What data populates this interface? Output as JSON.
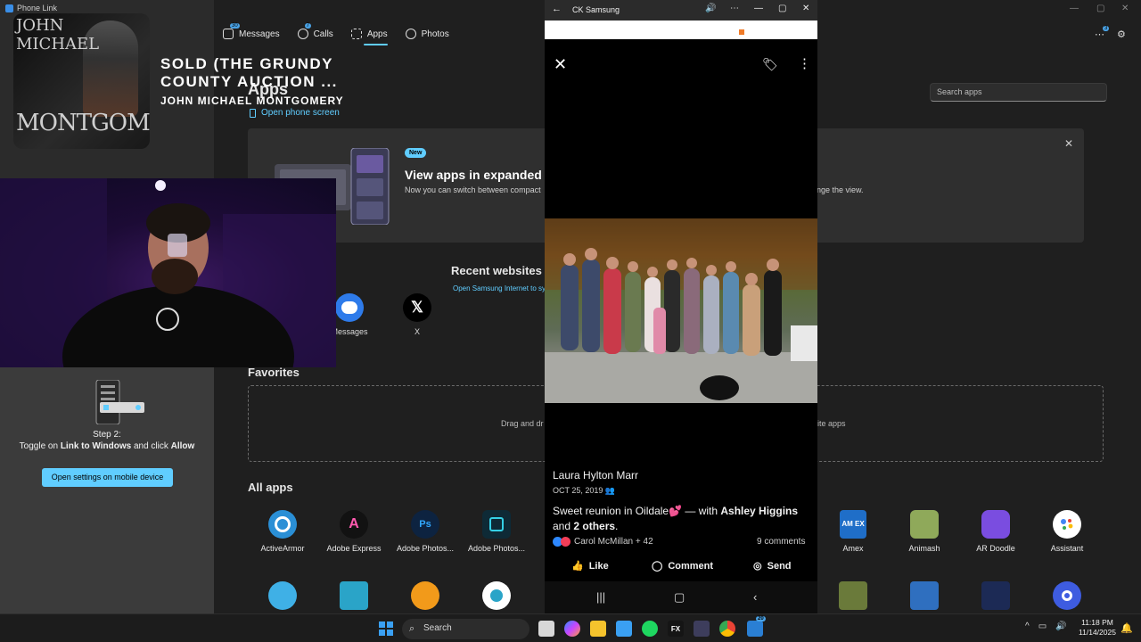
{
  "phonelink": {
    "window_title": "Phone Link",
    "nav": [
      {
        "label": "Messages",
        "badge": "30"
      },
      {
        "label": "Calls",
        "badge": "7"
      },
      {
        "label": "Apps",
        "badge": ""
      },
      {
        "label": "Photos",
        "badge": ""
      }
    ],
    "active_tab": "Apps",
    "notifications_badge": "3",
    "apps_heading": "Apps",
    "open_phone_link": "Open phone screen",
    "search_placeholder": "Search apps",
    "banner": {
      "new_badge": "New",
      "title": "View apps in expanded scr",
      "desc": "Now you can switch between compact",
      "desc_tail": "nge the view."
    },
    "recent": {
      "title": "Recent websites",
      "link": "Open Samsung Internet to sy",
      "apps": [
        {
          "label": "Messages",
          "glyph": ""
        },
        {
          "label": "X",
          "glyph": "𝕏"
        }
      ]
    },
    "favorites": {
      "title": "Favorites",
      "hint_start": "Drag and dr",
      "hint_end": "rite apps"
    },
    "all_apps": {
      "title": "All apps",
      "row1": [
        {
          "label": "ActiveArmor",
          "glyph": "",
          "color": "#2a8fd6"
        },
        {
          "label": "Adobe Express",
          "glyph": "A",
          "color": "#121212"
        },
        {
          "label": "Adobe Photos...",
          "glyph": "Ps",
          "color": "#0d2340"
        },
        {
          "label": "Adobe Photos...",
          "glyph": "",
          "color": "#0e2a36"
        },
        {
          "label": "Amex",
          "glyph": "AM EX",
          "color": "#1f6ec8"
        },
        {
          "label": "Animash",
          "glyph": "",
          "color": "#8fa95a"
        },
        {
          "label": "AR Doodle",
          "glyph": "",
          "color": "#7a4de0"
        },
        {
          "label": "Assistant",
          "glyph": "",
          "color": "#ffffff"
        }
      ],
      "row2_colors": [
        "#3fb0e6",
        "#2aa4c8",
        "#f29a1a",
        "#ffffff",
        "#6a7a3a",
        "#2f6fbf",
        "#1c2a55",
        "#3e5ce0"
      ]
    },
    "step": {
      "label": "Step 2:",
      "text_pre": "Toggle on ",
      "text_bold1": "Link to Windows",
      "text_mid": " and click ",
      "text_bold2": "Allow",
      "button": "Open settings on mobile device"
    }
  },
  "now_playing": {
    "album_top": "JOHN\nMICHAEL",
    "album_bottom": "MONTGOMERY",
    "title": "SOLD (THE GRUNDY COUNTY AUCTION ...",
    "artist": "JOHN MICHAEL MONTGOMERY"
  },
  "phone_window": {
    "title": "CK Samsung",
    "post": {
      "author": "Laura Hylton Marr",
      "date": "OCT 25, 2019",
      "text_pre": "Sweet reunion in Oildale",
      "text_emoji": "💕",
      "text_with": " — with ",
      "tag_name": "Ashley Higgins",
      "text_and": " and ",
      "tag_others": "2 others",
      "text_end": ".",
      "reactions": "Carol McMillan + 42",
      "comments": "9 comments",
      "actions": [
        "Like",
        "Comment",
        "Send"
      ]
    }
  },
  "taskbar": {
    "search": "Search",
    "badge": "20",
    "time": "11:18 PM",
    "date": "11/14/2025"
  }
}
